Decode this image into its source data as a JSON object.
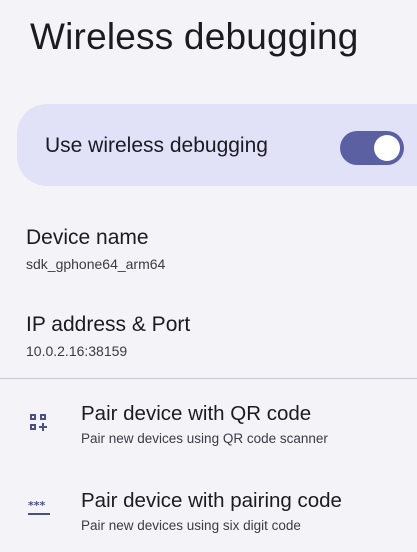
{
  "page": {
    "title": "Wireless debugging"
  },
  "main_switch": {
    "label": "Use wireless debugging",
    "enabled": true,
    "track_color": "#5b60a3",
    "card_color": "#e1e1f8"
  },
  "device_name": {
    "title": "Device name",
    "value": "sdk_gphone64_arm64"
  },
  "ip_address": {
    "title": "IP address & Port",
    "value": "10.0.2.16:38159"
  },
  "pair_options": [
    {
      "title": "Pair device with QR code",
      "summary": "Pair new devices using QR code scanner",
      "icon": "qr-code-scanner-icon"
    },
    {
      "title": "Pair device with pairing code",
      "summary": "Pair new devices using six digit code",
      "icon": "password-dots-icon"
    }
  ],
  "colors": {
    "accent": "#5b60a3",
    "background": "#f4f3f8"
  }
}
